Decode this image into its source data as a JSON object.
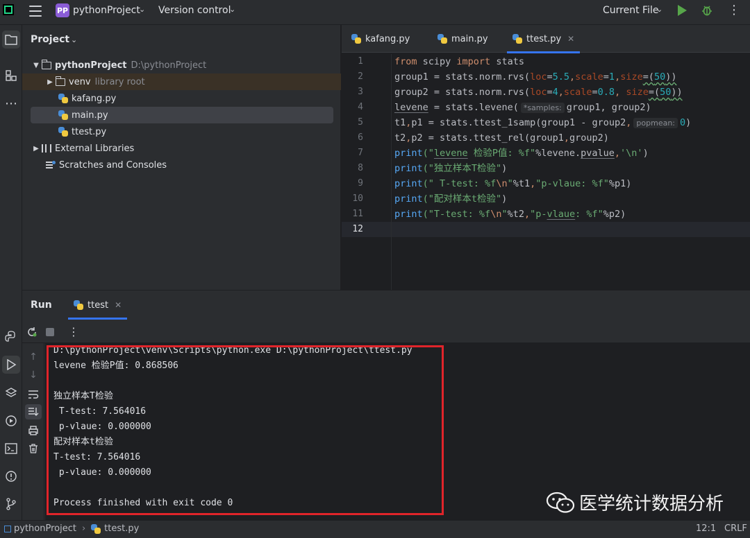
{
  "titlebar": {
    "project_badge": "PP",
    "project_name": "pythonProject",
    "vcs_label": "Version control",
    "run_config": "Current File"
  },
  "project_panel": {
    "title": "Project",
    "tree": [
      {
        "label": "pythonProject",
        "hint": "D:\\pythonProject"
      },
      {
        "label": "venv",
        "hint": "library root"
      },
      {
        "label": "kafang.py"
      },
      {
        "label": "main.py"
      },
      {
        "label": "ttest.py"
      },
      {
        "label": "External Libraries"
      },
      {
        "label": "Scratches and Consoles"
      }
    ]
  },
  "editor": {
    "tabs": [
      {
        "label": "kafang.py"
      },
      {
        "label": "main.py"
      },
      {
        "label": "ttest.py"
      }
    ],
    "line_numbers": [
      "1",
      "2",
      "3",
      "4",
      "5",
      "6",
      "7",
      "8",
      "9",
      "10",
      "11",
      "12"
    ],
    "current_line": "12",
    "inlay_hints": {
      "samples": "*samples:",
      "popmean": "popmean:"
    },
    "code": {
      "l1": {
        "a": "from",
        "b": " scipy ",
        "c": "import",
        "d": " stats"
      },
      "l2": {
        "a": "group1 = stats.norm.rvs(",
        "b": "loc",
        "c": "=",
        "d": "5.5",
        "e": ",",
        "f": "scale",
        "g": "=",
        "h": "1",
        "i": ",",
        "j": "size",
        "k": "=(",
        "l": "50",
        "m": "))"
      },
      "l3": {
        "a": "group2 = stats.norm.rvs(",
        "b": "loc",
        "c": "=",
        "d": "4",
        "e": ",",
        "f": "scale",
        "g": "=",
        "h": "0.8",
        "i": ", ",
        "j": "size",
        "k": "=(",
        "l": "50",
        "m": "))"
      },
      "l4": {
        "a": "levene",
        "b": " = stats.levene(",
        "c": "group1, group2)"
      },
      "l5": {
        "a": "t1",
        "b": ",",
        "c": "p1 = stats.ttest_1samp(group1 - group2",
        "d": ",",
        "e": "0",
        "f": ")"
      },
      "l6": {
        "a": "t2",
        "b": ",",
        "c": "p2 = stats.ttest_rel(group1",
        "d": ",",
        "e": "group2)"
      },
      "l7": {
        "a": "print",
        "b": "(\"",
        "c": "levene",
        "d": " 检验P值: %f\"",
        "e": "%levene.",
        "f": "pvalue",
        "g": ",",
        "h": "'\\n'",
        "i": ")"
      },
      "l8": {
        "a": "print",
        "b": "(\"独立样本T检验\"",
        "c": ")"
      },
      "l9": {
        "a": "print",
        "b": "(\" T-test: %f",
        "c": "\\n",
        "d": "\"",
        "e": "%t1",
        "f": ",",
        "g": "\"p-vlaue: %f\"",
        "h": "%p1)"
      },
      "l10": {
        "a": "print",
        "b": "(\"配对样本t检验\"",
        "c": ")"
      },
      "l11": {
        "a": "print",
        "b": "(\"T-test: %f",
        "c": "\\n",
        "d": "\"",
        "e": "%t2",
        "f": ",",
        "g": "\"p-",
        "h": "vlaue",
        "i": ": %f\"",
        "j": "%p2)"
      }
    }
  },
  "run_panel": {
    "title": "Run",
    "tab_label": "ttest",
    "output": [
      "D:\\pythonProject\\venv\\Scripts\\python.exe D:\\pythonProject\\ttest.py",
      "levene 检验P值: 0.868506",
      "",
      "独立样本T检验",
      " T-test: 7.564016",
      " p-vlaue: 0.000000",
      "配对样本t检验",
      "T-test: 7.564016",
      " p-vlaue: 0.000000",
      "",
      "Process finished with exit code 0"
    ]
  },
  "watermark": {
    "text": "医学统计数据分析"
  },
  "statusbar": {
    "crumb_project": "pythonProject",
    "crumb_file": "ttest.py",
    "position": "12:1",
    "line_sep": "CRLF"
  },
  "colors": {
    "accent": "#3574f0",
    "run_green": "#57a64a",
    "highlight_red": "#e0242a",
    "badge_purple": "#8a5cd6"
  },
  "icons": [
    "app-logo-icon",
    "hamburger-icon",
    "run-icon",
    "debug-icon",
    "more-icon",
    "folder-icon",
    "python-file-icon",
    "library-icon",
    "scratch-icon",
    "rerun-icon",
    "stop-icon",
    "wrap-icon",
    "print-icon",
    "trash-icon"
  ]
}
